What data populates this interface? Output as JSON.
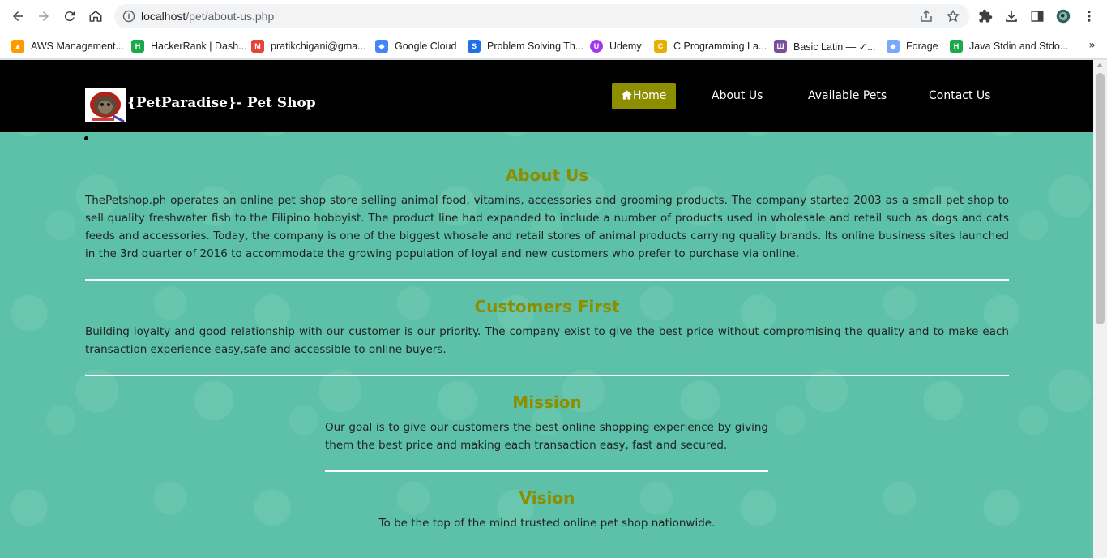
{
  "browser": {
    "url_host": "localhost",
    "url_path": "/pet/about-us.php",
    "bookmarks": [
      {
        "label": "AWS Management...",
        "color": "#ff9900",
        "glyph": "▲"
      },
      {
        "label": "HackerRank | Dash...",
        "color": "#1ba94c",
        "glyph": "H"
      },
      {
        "label": "pratikchigani@gma...",
        "color": "#ea4335",
        "glyph": "M"
      },
      {
        "label": "Google Cloud",
        "color": "#4285f4",
        "glyph": "◆"
      },
      {
        "label": "Problem Solving Th...",
        "color": "#1f6feb",
        "glyph": "S"
      },
      {
        "label": "Udemy",
        "color": "#a435f0",
        "glyph": "U"
      },
      {
        "label": "C Programming La...",
        "color": "#e8b000",
        "glyph": "C"
      },
      {
        "label": "Basic Latin — ✓...",
        "color": "#7b4f9d",
        "glyph": "Ш"
      },
      {
        "label": "Forage",
        "color": "#7aa7ff",
        "glyph": "◆"
      },
      {
        "label": "Java Stdin and Stdo...",
        "color": "#1ba94c",
        "glyph": "H"
      }
    ]
  },
  "site": {
    "brand": "{PetParadise}- Pet Shop",
    "nav": {
      "home": "Home",
      "about": "About Us",
      "pets": "Available Pets",
      "contact": "Contact Us"
    },
    "colors": {
      "accent": "#8d8d00",
      "background": "#5cc1a8",
      "navbar": "#000000"
    }
  },
  "content": {
    "about_title": "About Us",
    "about_text": "ThePetshop.ph operates an online pet shop store selling animal food, vitamins, accessories and grooming products. The company started 2003 as a small pet shop to sell quality freshwater fish to the Filipino hobbyist. The product line had expanded to include a number of products used in wholesale and retail such as dogs and cats feeds and accessories. Today, the company is one of the biggest whosale and retail stores of animal products carrying quality brands. Its online business sites launched in the 3rd quarter of 2016 to accommodate the growing population of loyal and new customers who prefer to purchase via online.",
    "customers_title": "Customers First",
    "customers_text": "Building loyalty and good relationship with our customer is our priority. The company exist to give the best price without compromising the quality and to make each transaction experience easy,safe and accessible to online buyers.",
    "mission_title": "Mission",
    "mission_text": "Our goal is to give our customers the best online shopping experience by giving them the best price and making each transaction easy, fast and secured.",
    "vision_title": "Vision",
    "vision_text": "To be the top of the mind trusted online pet shop nationwide."
  }
}
